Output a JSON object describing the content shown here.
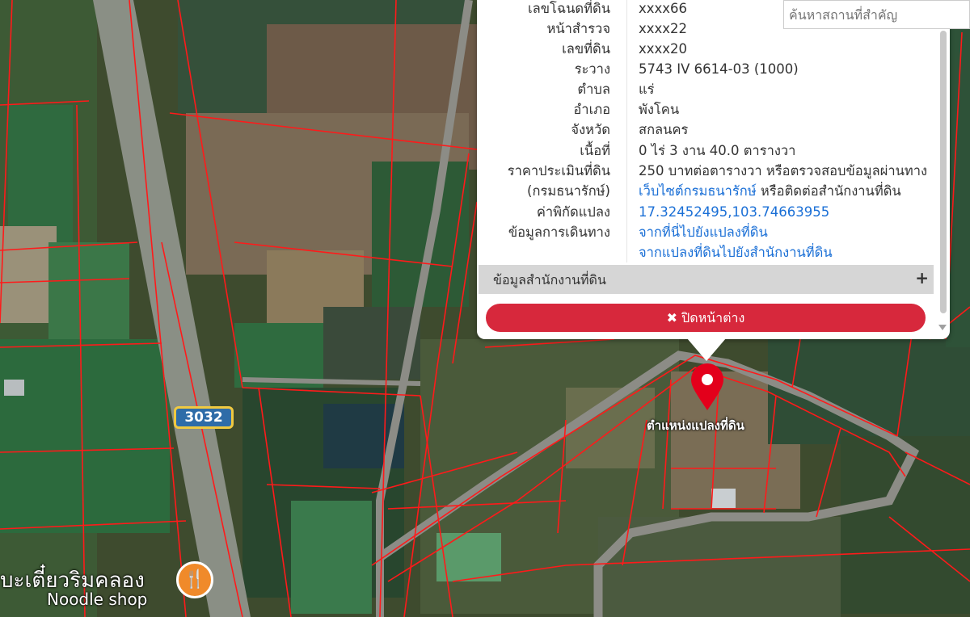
{
  "search": {
    "placeholder": "ค้นหาสถานที่สำคัญ"
  },
  "parcel_info": {
    "rows": [
      {
        "label": "เลขโฉนดที่ดิน",
        "value": "xxxx66"
      },
      {
        "label": "หน้าสำรวจ",
        "value": "xxxx22"
      },
      {
        "label": "เลขที่ดิน",
        "value": "xxxx20"
      },
      {
        "label": "ระวาง",
        "value": "5743 IV 6614-03 (1000)"
      },
      {
        "label": "ตำบล",
        "value": "แร่"
      },
      {
        "label": "อำเภอ",
        "value": "พังโคน"
      },
      {
        "label": "จังหวัด",
        "value": "สกลนคร"
      },
      {
        "label": "เนื้อที่",
        "value": "0 ไร่ 3 งาน 40.0 ตารางวา"
      }
    ],
    "appraisal_label": "ราคาประเมินที่ดิน",
    "appraisal_value": "250 บาทต่อตารางวา หรือตรวจสอบข้อมูลผ่านทาง",
    "treasury_label": "(กรมธนารักษ์)",
    "treasury_link": "เว็บไซต์กรมธนารักษ์",
    "treasury_suffix": " หรือติดต่อสำนักงานที่ดิน",
    "coords_label": "ค่าพิกัดแปลง",
    "coords_value": "17.32452495,103.74663955",
    "travel_label": "ข้อมูลการเดินทาง",
    "travel_link_1": "จากที่นี่ไปยังแปลงที่ดิน",
    "travel_link_2": "จากแปลงที่ดินไปยังสำนักงานที่ดิน"
  },
  "office_section": {
    "label": "ข้อมูลสำนักงานที่ดิน",
    "toggle": "+"
  },
  "close_button": {
    "icon": "✖",
    "label": "ปิดหน้าต่าง"
  },
  "map": {
    "pin_label": "ตำแหน่งแปลงที่ดิน",
    "route_number": "3032",
    "shop_name": "บะเตี๋ยวริมคลอง",
    "shop_type": "Noodle shop",
    "shop_icon": "fork-knife-icon",
    "pin_color": "#e3001b",
    "parcel_line_color": "#ff1a1a"
  }
}
